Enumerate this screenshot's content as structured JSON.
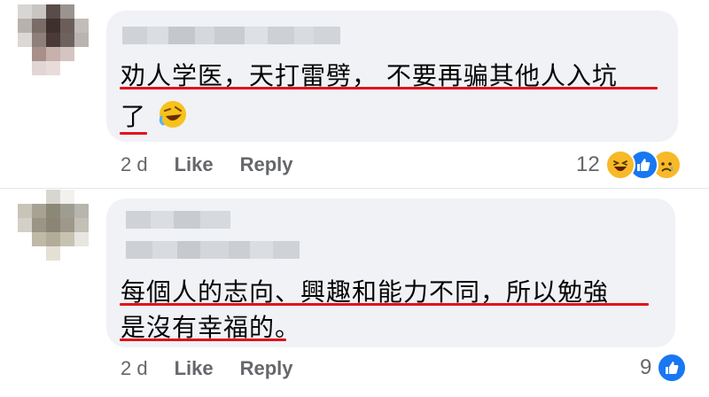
{
  "comments": [
    {
      "author": "",
      "lines": [
        "劝人学医，天打雷劈， 不要再骗其他人入坑",
        "了"
      ],
      "emoji": "rolling-laughing-emoji",
      "time": "2 d",
      "like_label": "Like",
      "reply_label": "Reply",
      "reaction_count": "12",
      "reactions": [
        "haha-icon",
        "like-icon",
        "sad-icon"
      ]
    },
    {
      "author": "",
      "lines": [
        "每個人的志向、興趣和能力不同，所以勉強",
        "是沒有幸福的。"
      ],
      "time": "2 d",
      "like_label": "Like",
      "reply_label": "Reply",
      "reaction_count": "9",
      "reactions": [
        "like-icon"
      ]
    }
  ],
  "colors": {
    "bubble": "#f0f2f5",
    "underline": "#e3101d",
    "meta_text": "#65676b",
    "like_blue": "#1877f2",
    "haha_yellow": "#f7b928"
  }
}
